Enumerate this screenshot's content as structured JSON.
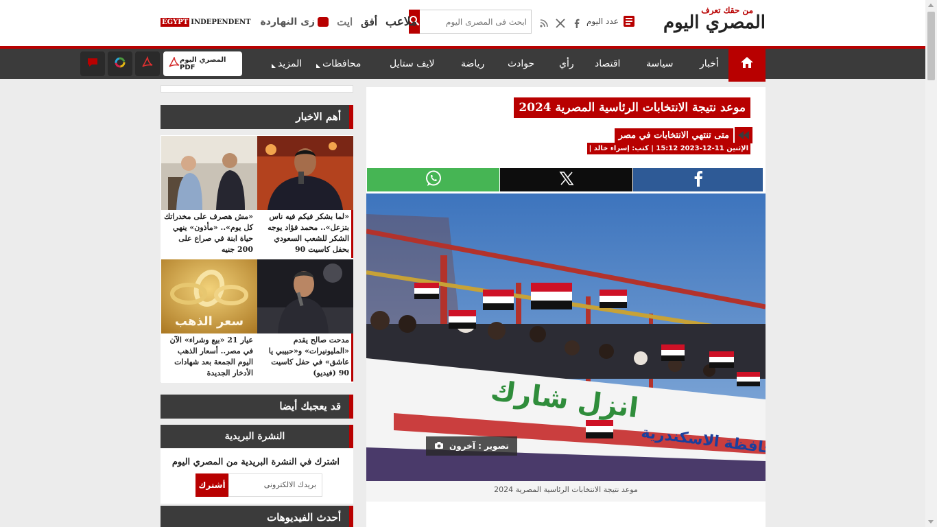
{
  "header": {
    "logo_tagline": "من حقك تعرف",
    "logo_text": "المصري اليوم",
    "issue_label": "عدد اليوم",
    "search_placeholder": "ابحث فى المصرى اليوم",
    "partners": {
      "egypt_label": "EGYPT",
      "independent_label": "INDEPENDENT",
      "zay_label": "زى النهاردة",
      "ib_label": "ايت",
      "ofoq_label": "أفق",
      "malaeb_label": "ملاعب"
    }
  },
  "nav": {
    "items": [
      "أخبار",
      "سياسة",
      "اقتصاد",
      "رأي",
      "حوادث",
      "رياضة",
      "لايف ستايل",
      "محافظات",
      "المزيد"
    ],
    "pdf_label": "المصري اليوم PDF"
  },
  "article": {
    "headline": "موعد نتيجة الانتخابات الرئاسية المصرية 2024",
    "subhead": "متى تنتهي الانتخابات في مصر",
    "meta": "الإثنين 11-12-2023 15:12 | كتب: إسراء خالد |",
    "photo_credit": "تصوير : آخرون",
    "caption": "موعد نتيجة الانتخابات الرئاسية المصرية 2024",
    "banner_text_1": "انزل شارك",
    "banner_text_2": "محافظة الاسكندرية"
  },
  "sidebar": {
    "top_news_title": "أهم الاخبار",
    "news": [
      {
        "title": "«لما بشكر فيكم فيه ناس بتزعل».. محمد فؤاد يوجه الشكر للشعب السعودي بحفل كاسيت 90"
      },
      {
        "title": "«مش هصرف على مخدراتك كل يوم».. «مأذون» ينهي حياة ابنة في صراع على 200 جنيه"
      },
      {
        "title": "مدحت صالح يقدم «المليونيرات» و«حبيبي يا عاشق» في حفل كاسيت 90 (فيديو)"
      },
      {
        "title": "عيار 21 «بيع وشراء» الآن في مصر.. أسعار الذهب اليوم الجمعة بعد شهادات الأدخار الجديدة"
      }
    ],
    "gold_overlay": "سعر الذهب",
    "may_like_title": "قد يعجبك أيضا",
    "newsletter_title": "النشرة البريدية",
    "newsletter_text": "اشترك في النشرة البريدية من المصري اليوم",
    "newsletter_placeholder": "بريدك الالكترونى",
    "subscribe_label": "أشترك",
    "videos_title": "أحدث الفيديوهات"
  },
  "colors": {
    "brand_red": "#b80000",
    "nav_dark": "#3b3b3b",
    "facebook": "#2e5a96",
    "x": "#0d0d0d",
    "whatsapp": "#46b554"
  }
}
